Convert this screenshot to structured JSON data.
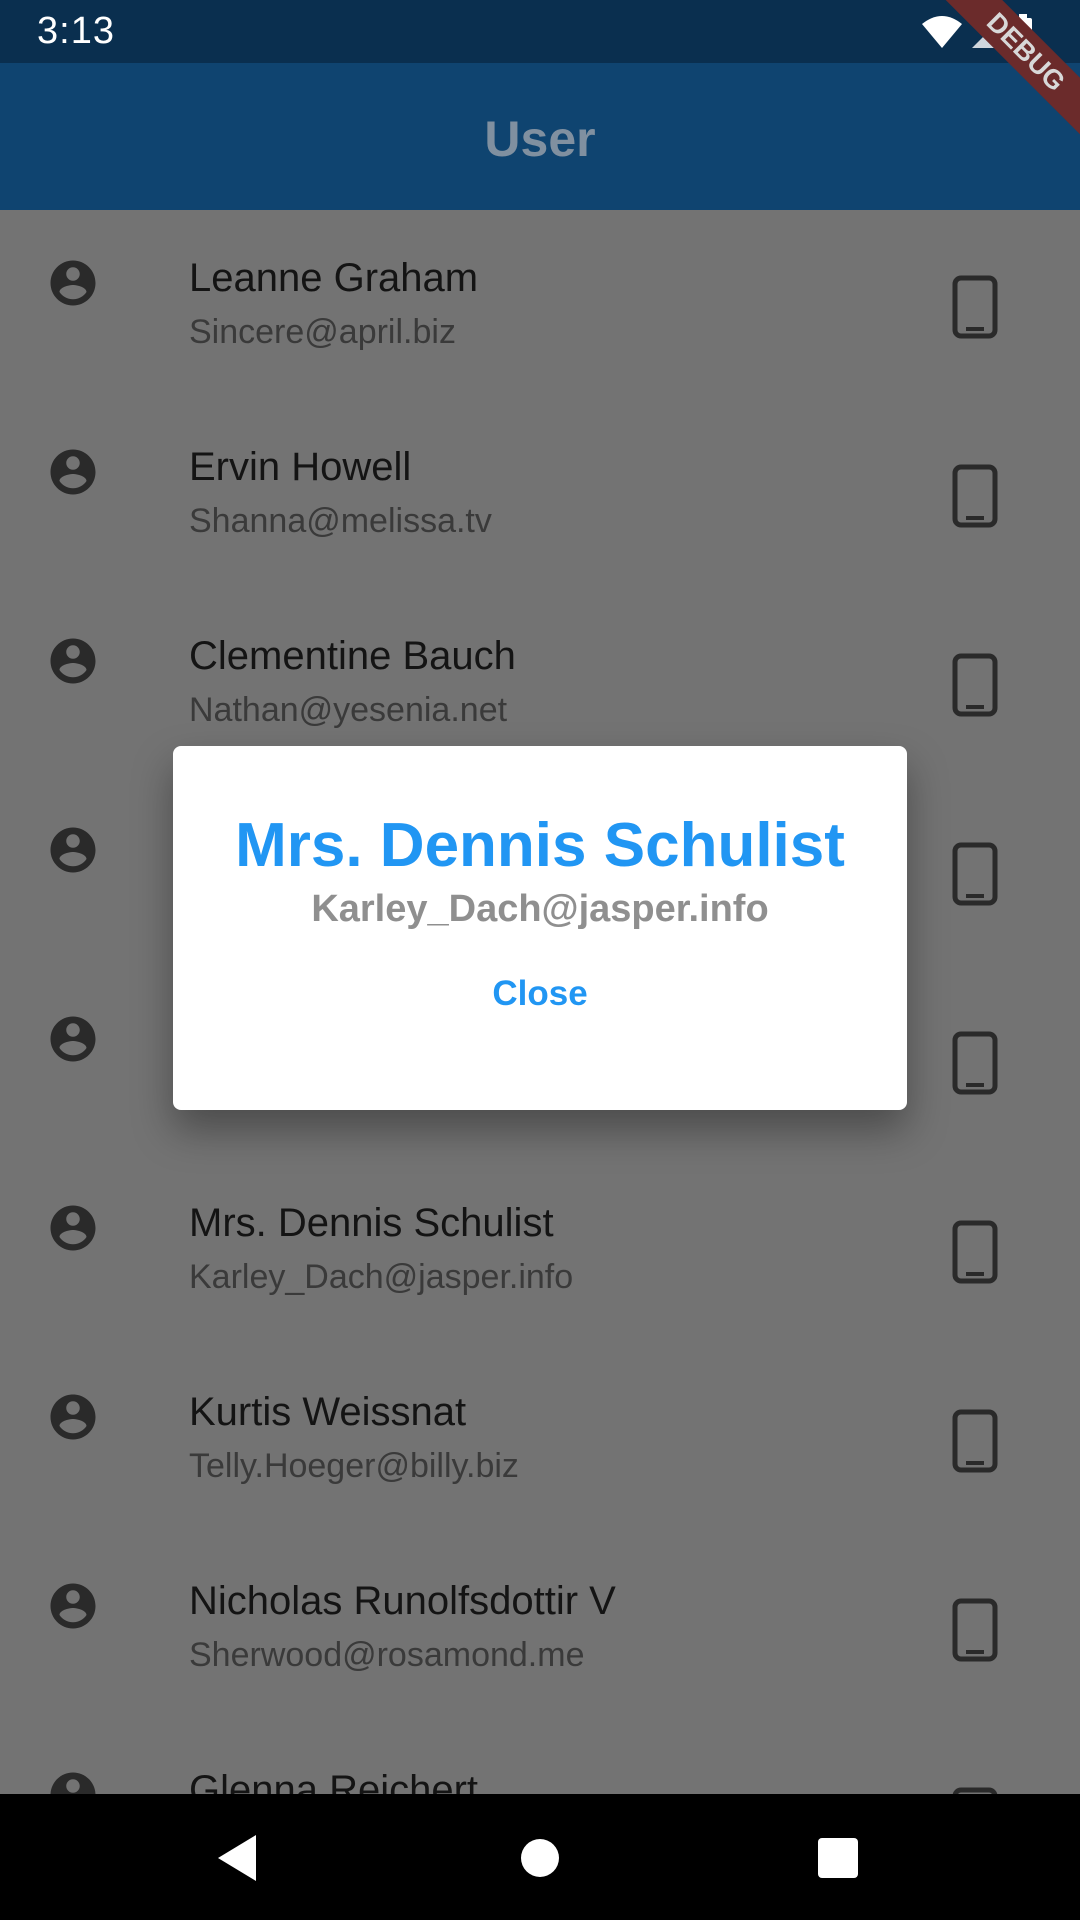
{
  "status_bar": {
    "time": "3:13",
    "icons": [
      "wifi-icon",
      "signal-icon",
      "battery-icon"
    ]
  },
  "debug_banner": "DEBUG",
  "app_bar": {
    "title": "User"
  },
  "users": [
    {
      "name": "Leanne Graham",
      "email": "Sincere@april.biz"
    },
    {
      "name": "Ervin Howell",
      "email": "Shanna@melissa.tv"
    },
    {
      "name": "Clementine Bauch",
      "email": "Nathan@yesenia.net"
    },
    {
      "name": "",
      "email": ""
    },
    {
      "name": "",
      "email": ""
    },
    {
      "name": "Mrs. Dennis Schulist",
      "email": "Karley_Dach@jasper.info"
    },
    {
      "name": "Kurtis Weissnat",
      "email": "Telly.Hoeger@billy.biz"
    },
    {
      "name": "Nicholas Runolfsdottir V",
      "email": "Sherwood@rosamond.me"
    },
    {
      "name": "Glenna Reichert",
      "email": ""
    }
  ],
  "dialog": {
    "name": "Mrs. Dennis Schulist",
    "email": "Karley_Dach@jasper.info",
    "close_label": "Close"
  },
  "nav_bar": {
    "buttons": [
      "back-icon",
      "home-icon",
      "recents-icon"
    ]
  },
  "colors": {
    "status_bar": "#0a2f4f",
    "app_bar": "#0f4470",
    "scrim_background": "#737373",
    "accent": "#2196f3",
    "debug_ribbon": "#6b2b2b"
  }
}
